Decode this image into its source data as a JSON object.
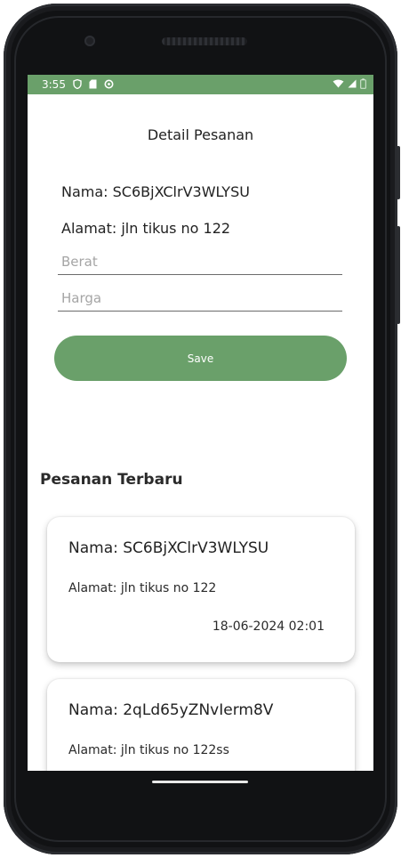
{
  "status_bar": {
    "time": "3:55",
    "left_icons": [
      "shield-icon",
      "sd-card-icon",
      "sync-icon"
    ],
    "right_icons": [
      "wifi-icon",
      "signal-icon",
      "battery-icon"
    ],
    "background_color": "#6aa06a"
  },
  "page": {
    "title": "Detail Pesanan",
    "nama_line": "Nama: SC6BjXClrV3WLYSU",
    "alamat_line": "Alamat: jln tikus no 122"
  },
  "form": {
    "berat": {
      "placeholder": "Berat",
      "value": ""
    },
    "harga": {
      "placeholder": "Harga",
      "value": ""
    },
    "save_label": "Save",
    "button_color": "#6aa06a"
  },
  "recent": {
    "heading": "Pesanan Terbaru",
    "cards": [
      {
        "nama": "Nama: SC6BjXClrV3WLYSU",
        "alamat": "Alamat: jln tikus no 122",
        "tanggal": "18-06-2024 02:01"
      },
      {
        "nama": "Nama: 2qLd65yZNvIerm8V",
        "alamat": "Alamat: jln tikus no 122ss"
      }
    ]
  }
}
